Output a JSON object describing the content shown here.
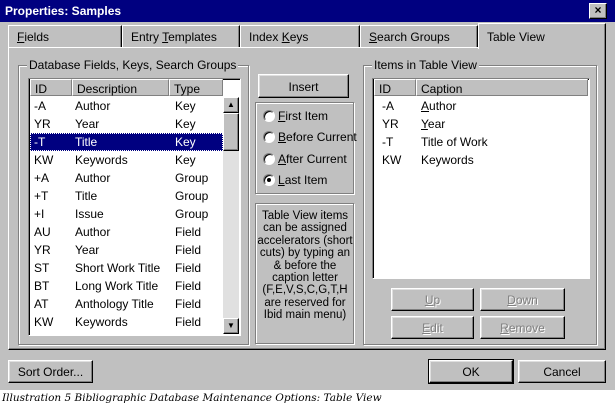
{
  "window": {
    "title": "Properties: Samples",
    "close_glyph": "×"
  },
  "tabs": [
    {
      "label": "Fields",
      "accel": "F",
      "rest": "ields"
    },
    {
      "label": "Entry Templates",
      "accel": "T",
      "pre": "Entry ",
      "rest": "emplates"
    },
    {
      "label": "Index Keys",
      "accel": "K",
      "pre": "Index ",
      "rest": "eys"
    },
    {
      "label": "Search Groups",
      "accel": "S",
      "rest": "earch Groups"
    },
    {
      "label": "Table View"
    }
  ],
  "left_group": {
    "label": "Database Fields, Keys, Search Groups",
    "columns": {
      "id": "ID",
      "description": "Description",
      "type": "Type"
    },
    "rows": [
      {
        "id": "-A",
        "description": "Author",
        "type": "Key"
      },
      {
        "id": "YR",
        "description": "Year",
        "type": "Key"
      },
      {
        "id": "-T",
        "description": "Title",
        "type": "Key",
        "selected": true
      },
      {
        "id": "KW",
        "description": "Keywords",
        "type": "Key"
      },
      {
        "id": "+A",
        "description": "Author",
        "type": "Group"
      },
      {
        "id": "+T",
        "description": "Title",
        "type": "Group"
      },
      {
        "id": "+I",
        "description": "Issue",
        "type": "Group"
      },
      {
        "id": "AU",
        "description": "Author",
        "type": "Field"
      },
      {
        "id": "YR",
        "description": "Year",
        "type": "Field"
      },
      {
        "id": "ST",
        "description": "Short Work Title",
        "type": "Field"
      },
      {
        "id": "BT",
        "description": "Long Work Title",
        "type": "Field"
      },
      {
        "id": "AT",
        "description": "Anthology Title",
        "type": "Field"
      },
      {
        "id": "KW",
        "description": "Keywords",
        "type": "Field"
      }
    ]
  },
  "insert_panel": {
    "insert_label": "Insert",
    "options": [
      {
        "label": "First Item",
        "accel": "F",
        "rest": "irst Item",
        "checked": false
      },
      {
        "label": "Before Current",
        "accel": "B",
        "rest": "efore Current",
        "checked": false
      },
      {
        "label": "After Current",
        "accel": "A",
        "rest": "fter Current",
        "checked": false
      },
      {
        "label": "Last Item",
        "accel": "L",
        "rest": "ast Item",
        "checked": true
      }
    ],
    "help_lines": [
      "Table View items",
      "can be assigned",
      "accelerators (short",
      "cuts) by typing an",
      "& before the",
      "caption letter",
      "(F,E,V,S,C,G,T,H",
      "are reserved for",
      "Ibid main menu)"
    ]
  },
  "right_group": {
    "label": "Items in Table View",
    "columns": {
      "id": "ID",
      "caption": "Caption"
    },
    "rows": [
      {
        "id": "-A",
        "caption": "Author",
        "accel": "A",
        "rest": "uthor"
      },
      {
        "id": "YR",
        "caption": "Year",
        "accel": "Y",
        "rest": "ear"
      },
      {
        "id": "-T",
        "caption": "Title of Work"
      },
      {
        "id": "KW",
        "caption": "Keywords"
      }
    ],
    "buttons": {
      "up": {
        "label": "Up",
        "accel": "U",
        "rest": "p"
      },
      "down": {
        "label": "Down",
        "accel": "D",
        "rest": "own"
      },
      "edit": {
        "label": "Edit",
        "accel": "E",
        "rest": "dit"
      },
      "remove": {
        "label": "Remove",
        "accel": "R",
        "rest": "emove"
      }
    }
  },
  "footer": {
    "sort_order": "Sort Order...",
    "ok": "OK",
    "cancel": "Cancel"
  },
  "figure_caption": "Illustration 5 Bibliographic Database Maintenance Options: Table View",
  "colors": {
    "face": "#c0c0c0",
    "title_bar": "#000080",
    "selection": "#000080"
  }
}
